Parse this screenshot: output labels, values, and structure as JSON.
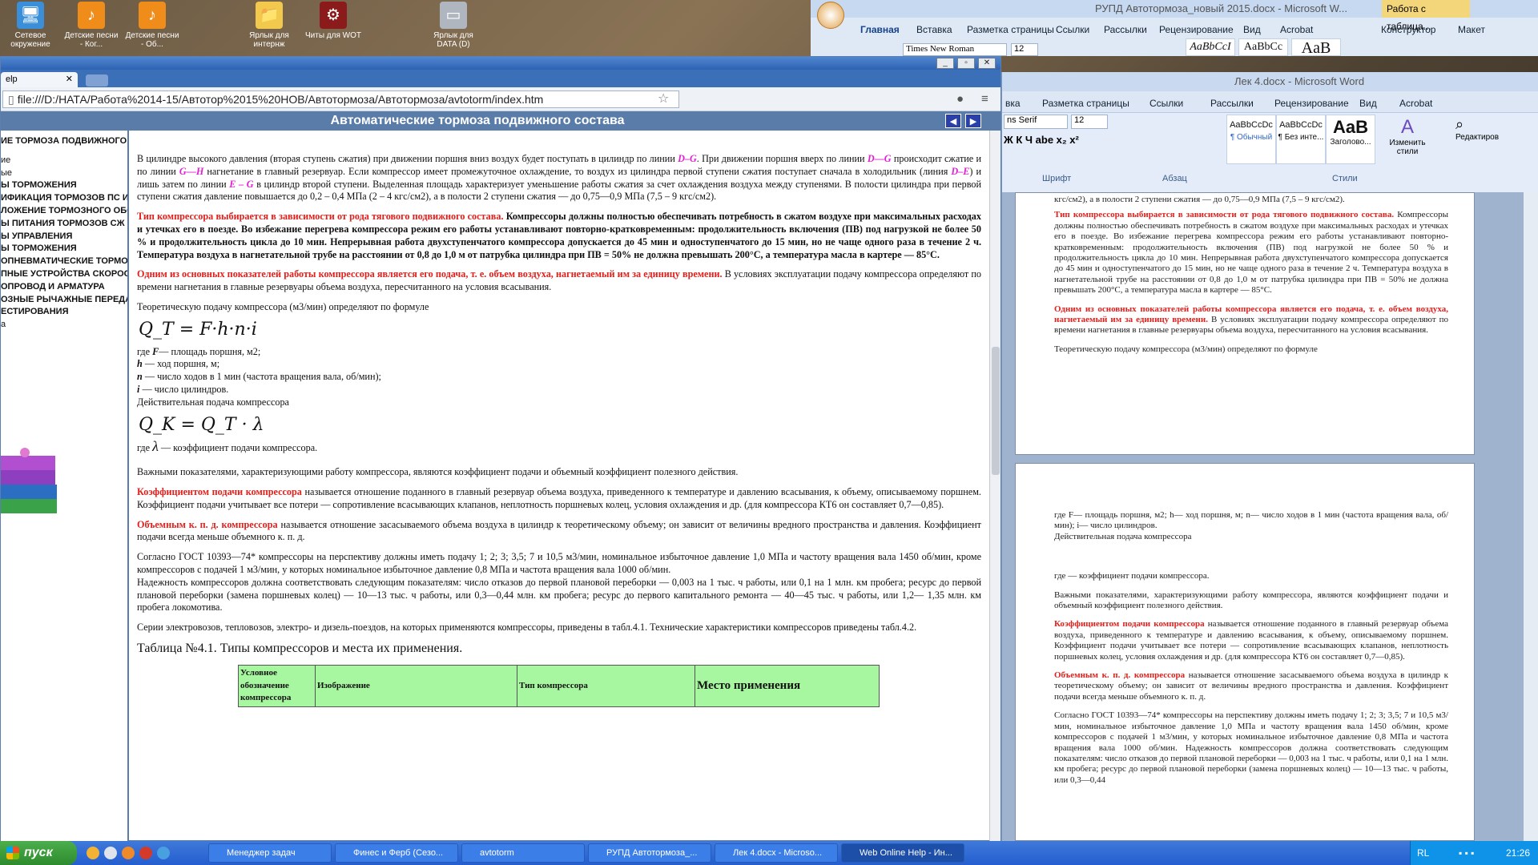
{
  "desktop_icons": [
    {
      "label": "Сетевое окружение"
    },
    {
      "label": "Детские песни - Ког..."
    },
    {
      "label": "Детские песни - Об..."
    },
    {
      "label": "Ярлык для интернж"
    },
    {
      "label": "Читы для WOT"
    },
    {
      "label": "Ярлык для DATA (D)"
    }
  ],
  "browser": {
    "tab_label": "elp",
    "url": "file:///D:/НАТА/Работа%2014-15/Автотор%2015%20НОВ/Автотормоза/Автотормоза/avtotorm/index.htm",
    "page_title": "Автоматические тормоза подвижного состава",
    "nav_prev": "◀",
    "nav_next": "▶"
  },
  "sidebar": [
    "ИЕ ТОРМОЗА ПОДВИЖНОГО",
    "ие",
    "ые",
    "Ы ТОРМОЖЕНИЯ",
    "ИФИКАЦИЯ ТОРМОЗОВ ПС И",
    "ЛОЖЕНИЕ ТОРМОЗНОГО ОБО",
    "Ы ПИТАНИЯ ТОРМОЗОВ СЖ",
    "Ы УПРАВЛЕНИЯ",
    "Ы ТОРМОЖЕНИЯ",
    "ОПНЕВМАТИЧЕСКИЕ ТОРМОЗ",
    "ПНЫЕ УСТРОЙСТВА СКОРОСТ",
    "ОПРОВОД И АРМАТУРА",
    "ОЗНЫЕ РЫЧАЖНЫЕ ПЕРЕДАЧ",
    "ЕСТИРОВАНИЯ",
    "а"
  ],
  "content": {
    "p1": {
      "a": "В цилиндре высокого давления (вторая ступень сжатия) при движении поршня вниз воздух будет поступать в цилиндр по линии ",
      "l1": "D–G",
      "b": ". При движении поршня вверх по линии ",
      "l2": "D—G",
      "c": " происходит сжатие и по линии ",
      "l3": "G—H",
      "d": " нагнетание в главный резервуар. Если компрессор имеет промежуточное охлаждение, то воздух из цилиндра первой ступени сжатия поступает сначала в холодильник (линия ",
      "l4": "D–E",
      "e": ") и лишь затем по линии ",
      "l5": "E – G",
      "f": " в цилиндр второй ступени. Выделенная площадь характеризует уменьшение работы сжатия за счет охлаждения воздуха между ступенями. В полости цилиндра при первой ступени сжатия давление повышается до 0,2 – 0,4 МПа (2 – 4 кгс/см2), а в полости 2 ступени сжатия — до 0,75—0,9 МПа (7,5 – 9 кгс/см2)."
    },
    "p2_red": "Тип компрессора выбирается в зависимости от рода тягового подвижного состава.",
    "p2_bold": " Компрессоры должны полностью обеспечивать потребность в сжатом воздухе при максимальных расходах и утечках его в поезде. Во избежание перегрева компрессора режим его работы устанавливают повторно-кратковременным: продолжительность включения (ПВ) под нагрузкой не более 50 % и продолжительность цикла до 10 мин. Непрерывная работа двухступенчатого компрессора допускается до 45 мин и одноступенчатого до 15 мин, но не чаще одного раза в течение 2 ч. Температура воздуха в нагнетательной трубе на расстоянии от 0,8 до 1,0 м от патрубка цилиндра при ПВ = 50% не должна превышать 200°С, а температура масла в картере — 85°С.",
    "p3_red": "Одним из основных показателей работы компрессора является его подача, т. е. объем воздуха, нагнетаемый им за единицу времени.",
    "p3_rest": " В условиях эксплуатации подачу компрессора определяют по времени нагнетания в главные резервуары объема воздуха, пересчитанного на условия всасывания.",
    "p4": "Теоретическую подачу компрессора (м3/мин) определяют по формуле",
    "formula1": "Q_T = F·h·n·i",
    "defs": [
      {
        "sym": "F",
        "text": "— площадь поршня, м2;"
      },
      {
        "sym": "h",
        "text": " — ход поршня, м;"
      },
      {
        "sym": "n",
        "text": " — число ходов в 1 мин (частота вращения вала, об/мин);"
      },
      {
        "sym": "i",
        "text": " — число цилиндров."
      }
    ],
    "p5": "Действительная подача компрессора",
    "formula2": "Q_K = Q_T · λ",
    "p6_a": "где ",
    "p6_sym": "λ",
    "p6_b": " — коэффициент подачи компрессора.",
    "p7": "Важными показателями, характеризующими работу компрессора, являются коэффициент подачи и объемный коэффициент полезного действия.",
    "p8_red": "Коэффициентом подачи компрессора",
    "p8_rest": " называется отношение поданного в главный резервуар объема воздуха, приведенного к температуре и давлению всасывания, к объему, описываемому поршнем. Коэффициент подачи учитывает все потери — сопротивление всасывающих клапанов, неплотность поршневых колец, условия охлаждения и др. (для компрессора КТ6 он составляет 0,7—0,85).",
    "p9_red": "Объемным к. п. д. компрессора",
    "p9_rest": " называется отношение засасываемого объема воздуха в цилиндр к теоретическому объему; он зависит от величины вредного пространства и давления. Коэффициент подачи всегда меньше объемного к. п. д.",
    "p10": "Согласно ГОСТ 10393—74* компрессоры на перспективу должны иметь подачу 1; 2; 3; 3,5; 7 и 10,5 м3/мин, номинальное избыточное давление 1,0 МПа и частоту вращения вала 1450 об/мин, кроме компрессоров с подачей 1 м3/мин, у которых номинальное избыточное давление 0,8 МПа и частота вращения вала 1000 об/мин.",
    "p11": "Надежность компрессоров должна соответствовать следующим показателям: число отказов до первой плановой переборки — 0,003 на 1 тыс. ч работы, или 0,1 на 1 млн. км пробега; ресурс до первой плановой переборки (замена поршневых колец) — 10—13 тыс. ч работы, или 0,3—0,44 млн. км пробега; ресурс до первого капитального ремонта — 40—45 тыс. ч работы, или 1,2— 1,35 млн. км пробега локомотива.",
    "p12": "Серии электровозов, тепловозов, электро- и дизель-поездов, на которых применяются компрессоры, приведены в табл.4.1. Технические характеристики компрессоров приведены табл.4.2.",
    "table_title": "Таблица №4.1.  Типы компрессоров и места их применения.",
    "table_headers": [
      "Условное обозначение компрессора",
      "Изображение",
      "Тип компрессора",
      "Место применения"
    ]
  },
  "word1": {
    "title": "РУПД Автотормоза_новый 2015.docx - Microsoft W...",
    "context_tab": "Работа с таблица...",
    "tabs": [
      "Главная",
      "Вставка",
      "Разметка страницы",
      "Ссылки",
      "Рассылки",
      "Рецензирование",
      "Вид",
      "Acrobat",
      "Конструктор",
      "Макет"
    ],
    "font": "Times New Roman",
    "size": "12",
    "styles": [
      "AaBbCcI",
      "AaBbCc",
      "AaB"
    ]
  },
  "word2": {
    "title": "Лек 4.docx - Microsoft Word",
    "tabs": [
      "вка",
      "Разметка страницы",
      "Ссылки",
      "Рассылки",
      "Рецензирование",
      "Вид",
      "Acrobat"
    ],
    "font": "ns Serif",
    "size": "12",
    "styles": [
      {
        "sample": "AaBbCcDc",
        "name": "¶ Обычный"
      },
      {
        "sample": "AaBbCcDc",
        "name": "¶ Без инте..."
      },
      {
        "sample": "AaB",
        "name": "Заголово..."
      }
    ],
    "change_styles": "Изменить стили",
    "edit": "Редактиров",
    "groups": [
      "Шрифт",
      "Абзац",
      "Стили"
    ],
    "page1": {
      "top": "кгс/см2), а в полости 2 ступени сжатия — до 0,75—0,9 МПа (7,5 – 9 кгс/см2).",
      "red1": "Тип компрессора выбирается в зависимости от рода тягового подвижного состава.",
      "rest1": " Компрессоры должны полностью обеспечивать потребность в сжатом воздухе при максимальных расходах и утечках его в поезде. Во избежание перегрева компрессора режим его работы устанавливают повторно-кратковременным: продолжительность включения (ПВ) под нагрузкой не более 50 % и продолжительность цикла до 10 мин. Непрерывная работа двухступенчатого компрессора допускается до 45 мин и одноступенчатого до 15 мин, но не чаще одного раза в течение 2 ч. Температура воздуха в нагнетательной трубе на расстоянии от 0,8 до 1,0 м от патрубка цилиндра при ПВ = 50% не должна превышать 200°С, а температура масла в картере — 85°С.",
      "red2": "Одним из основных показателей работы компрессора является его подача, т. е. объем воздуха, нагнетаемый им за единицу времени.",
      "rest2": " В условиях эксплуатации подачу компрессора определяют по времени нагнетания в главные резервуары объема воздуха, пересчитанного на условия всасывания.",
      "p3": "Теоретическую подачу компрессора (м3/мин) определяют по формуле"
    },
    "page2": {
      "defs": "где F— площадь поршня, м2; h— ход поршня, м; n— число ходов в 1 мин (частота вращения вала, об/мин); i— число цилиндров.",
      "p1": "Действительная подача компрессора",
      "p2": "где — коэффициент подачи компрессора.",
      "p3": "Важными показателями, характеризующими работу компрессора, являются коэффициент подачи и объемный коэффициент полезного действия.",
      "red4": "Коэффициентом подачи компрессора",
      "rest4": " называется отношение поданного в главный резервуар объема воздуха, приведенного к температуре и давлению всасывания, к объему, описываемому поршнем. Коэффициент подачи учитывает все потери — сопротивление всасывающих клапанов, неплотность поршневых колец, условия охлаждения и др. (для компрессора КТ6 он составляет 0,7—0,85).",
      "red5": "Объемным к. п. д. компрессора",
      "rest5": " называется отношение засасываемого объема воздуха в цилиндр к теоретическому объему; он зависит от величины вредного пространства и давления. Коэффициент подачи всегда меньше объемного к. п. д.",
      "p6": "Согласно ГОСТ 10393—74* компрессоры на перспективу должны иметь подачу 1; 2; 3; 3,5; 7 и 10,5 м3/мин, номинальное избыточное давление 1,0 МПа и частоту вращения вала 1450 об/мин, кроме компрессоров с подачей 1 м3/мин, у которых номинальное избыточное давление 0,8 МПа и частота вращения вала 1000 об/мин. Надежность компрессоров должна соответствовать следующим показателям: число отказов до первой плановой переборки — 0,003 на 1 тыс. ч работы, или 0,1 на 1 млн. км пробега; ресурс до первой плановой переборки (замена поршневых колец) — 10—13 тыс. ч работы, или 0,3—0,44"
    }
  },
  "taskbar": {
    "start": "пуск",
    "tasks": [
      "Менеджер задач",
      "Финес и Ферб (Сезо...",
      "avtotorm",
      "РУПД Автотормоза_...",
      "Лек 4.docx - Microso...",
      "Web Online Help - Ин..."
    ],
    "lang": "RL",
    "clock": "21:26"
  }
}
